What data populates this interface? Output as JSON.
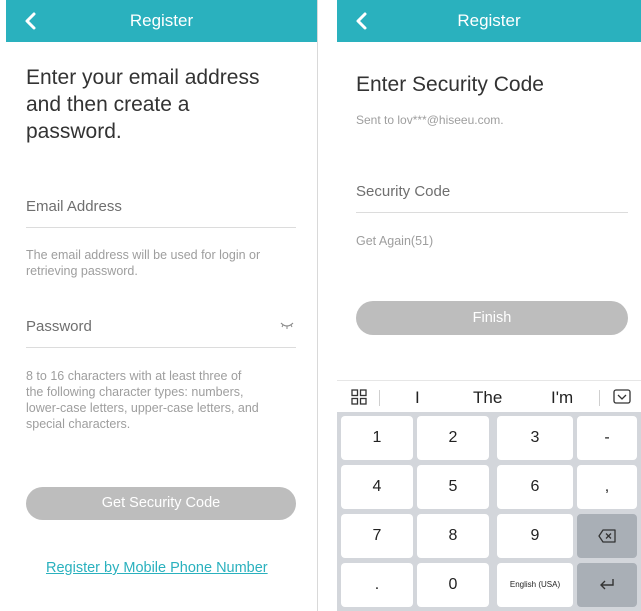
{
  "left": {
    "header_title": "Register",
    "heading_lines": [
      "Enter your email address",
      "and then create a",
      "password."
    ],
    "email": {
      "label": "Email Address"
    },
    "email_hint_lines": [
      "The email address will be used for login or",
      "retrieving password."
    ],
    "password": {
      "label": "Password"
    },
    "password_hint_lines": [
      "8 to 16 characters with at least three of",
      "the following character types: numbers,",
      "lower-case letters, upper-case letters, and",
      "special characters."
    ],
    "submit_label": "Get Security Code",
    "alt_link": "Register by Mobile Phone Number"
  },
  "right": {
    "header_title": "Register",
    "heading": "Enter Security Code",
    "sent_to": "Sent to lov***@hiseeu.com.",
    "code": {
      "label": "Security Code"
    },
    "resend": "Get Again(51)",
    "finish_label": "Finish",
    "suggestions": [
      "I",
      "The",
      "I'm"
    ],
    "keys": [
      [
        "1",
        "2",
        "3",
        "-"
      ],
      [
        "4",
        "5",
        "6",
        ","
      ],
      [
        "7",
        "8",
        "9",
        ""
      ],
      [
        ".",
        "0",
        "English (USA)",
        ""
      ]
    ]
  },
  "colors": {
    "accent": "#2ab1be",
    "button_disabled": "#bdbdbd"
  },
  "icons": [
    "back-arrow-icon",
    "eye-closed-icon",
    "grid-icon",
    "keyboard-hide-icon",
    "backspace-icon",
    "enter-icon"
  ]
}
